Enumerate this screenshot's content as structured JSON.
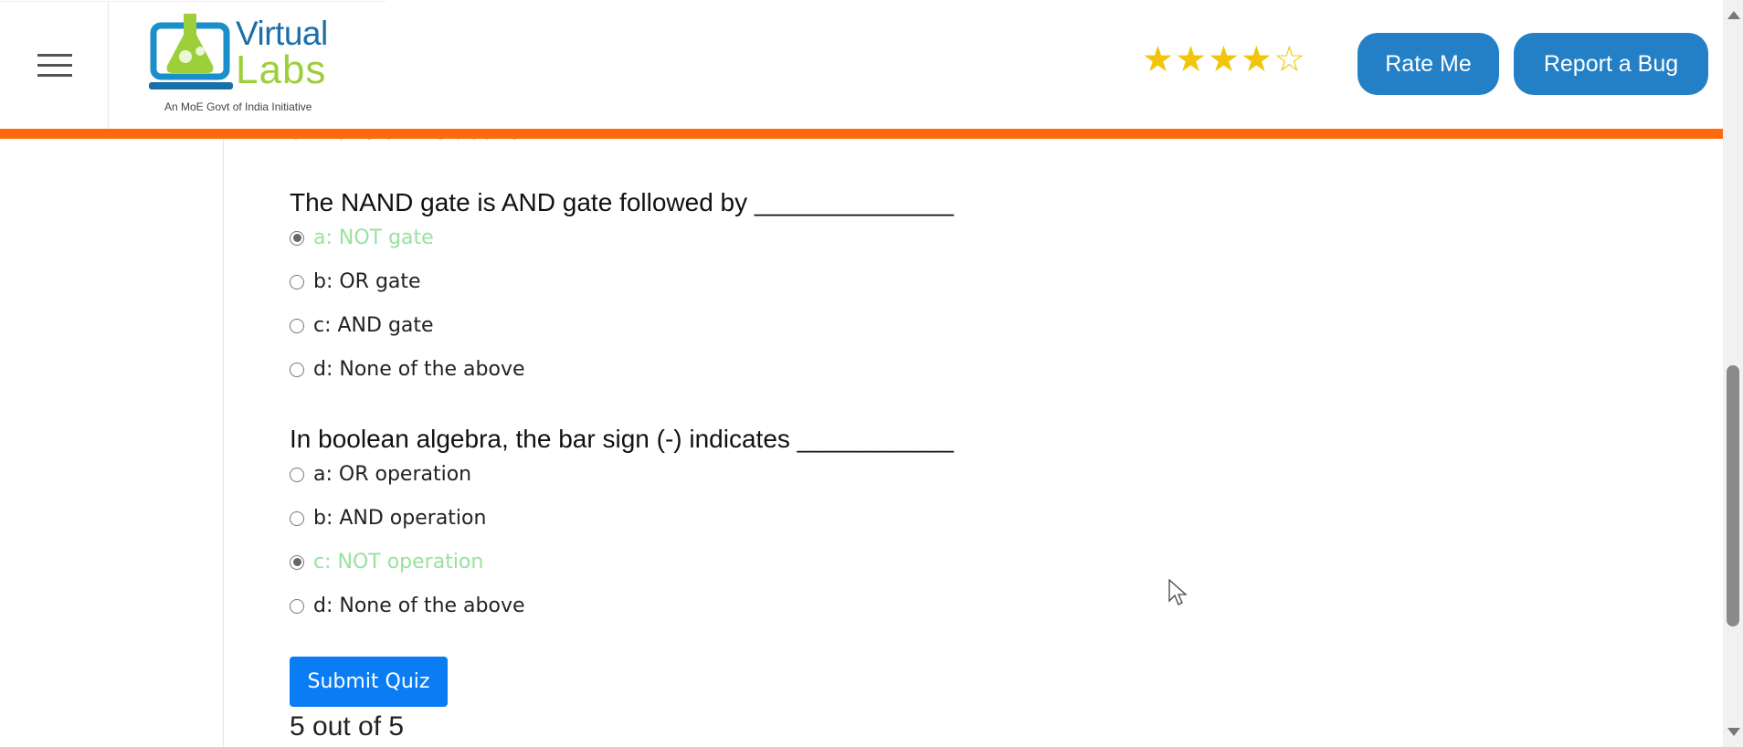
{
  "header": {
    "logo": {
      "title_line1": "Virtual",
      "title_line2": "Labs",
      "tagline": "An MoE Govt of India Initiative"
    },
    "rating": {
      "value": 4,
      "max": 5
    },
    "rate_button": "Rate Me",
    "bug_button": "Report a Bug"
  },
  "quiz": {
    "partial_option": "d: None of the above",
    "questions": [
      {
        "text": "The NAND gate is AND gate followed by ______________",
        "options": [
          {
            "label": "a: NOT gate",
            "selected": true
          },
          {
            "label": "b: OR gate",
            "selected": false
          },
          {
            "label": "c: AND gate",
            "selected": false
          },
          {
            "label": "d: None of the above",
            "selected": false
          }
        ]
      },
      {
        "text": "In boolean algebra, the bar sign (-) indicates ___________",
        "options": [
          {
            "label": "a: OR operation",
            "selected": false
          },
          {
            "label": "b: AND operation",
            "selected": false
          },
          {
            "label": "c: NOT operation",
            "selected": true
          },
          {
            "label": "d: None of the above",
            "selected": false
          }
        ]
      }
    ],
    "submit_label": "Submit Quiz",
    "score": "5 out of 5"
  },
  "colors": {
    "orange_bar": "#ff6a0d",
    "header_button": "#2380c6",
    "submit_button": "#0a7cf4",
    "selected_option": "#98e2a0",
    "star": "#f2c40a"
  }
}
